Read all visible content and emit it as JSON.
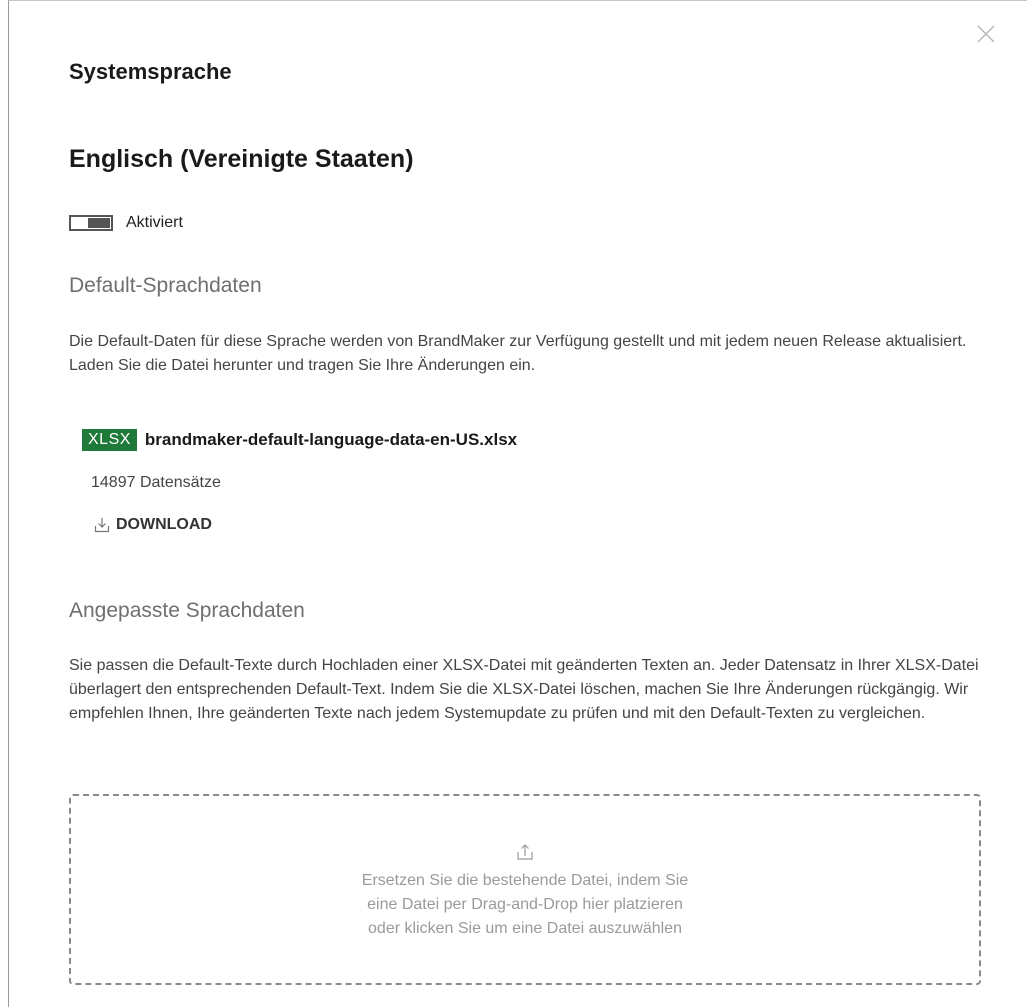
{
  "dialog": {
    "title": "Systemsprache",
    "close_icon": "close-icon"
  },
  "language": {
    "name": "Englisch (Vereinigte Staaten)",
    "toggle_label": "Aktiviert",
    "enabled": true
  },
  "default_data": {
    "heading": "Default-Sprachdaten",
    "description": "Die Default-Daten für diese Sprache werden von BrandMaker zur Verfügung gestellt und mit jedem neuen Release aktualisiert. Laden Sie die Datei herunter und tragen Sie Ihre Änderungen ein.",
    "file": {
      "badge": "XLSX",
      "badge_color": "#1f7a3a",
      "name": "brandmaker-default-language-data-en-US.xlsx",
      "records": "14897 Datensätze"
    },
    "download_label": "DOWNLOAD",
    "download_icon": "download-icon"
  },
  "custom_data": {
    "heading": "Angepasste Sprachdaten",
    "description": "Sie passen die Default-Texte durch Hochladen einer XLSX-Datei mit geänderten Texten an. Jeder Datensatz in Ihrer XLSX-Datei überlagert den entsprechenden Default-Text. Indem Sie die XLSX-Datei löschen, machen Sie Ihre Änderungen rückgängig. Wir empfehlen Ihnen, Ihre geänderten Texte nach jedem Systemupdate zu prüfen und mit den Default-Texten zu vergleichen.",
    "dropzone": {
      "icon": "upload-icon",
      "line1": "Ersetzen Sie die bestehende Datei, indem Sie",
      "line2": "eine Datei per Drag-and-Drop hier platzieren",
      "line3": "oder klicken Sie um eine Datei auszuwählen"
    }
  }
}
